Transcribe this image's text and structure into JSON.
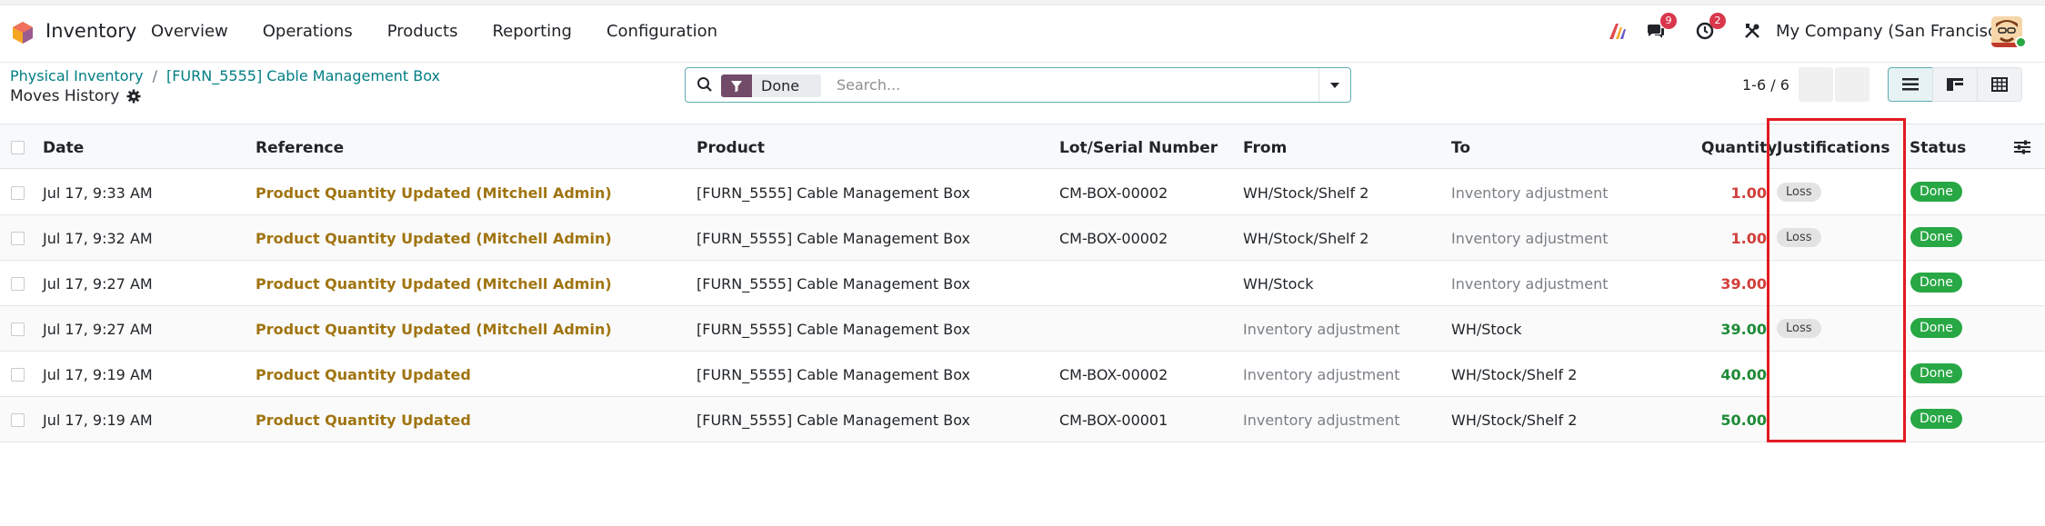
{
  "app": {
    "name": "Inventory"
  },
  "menu": [
    "Overview",
    "Operations",
    "Products",
    "Reporting",
    "Configuration"
  ],
  "systray": {
    "messages_count": "9",
    "activities_count": "2",
    "company": "My Company (San Francisco)"
  },
  "breadcrumb": {
    "crumb1": "Physical Inventory",
    "separator": "/",
    "crumb2": "[FURN_5555] Cable Management Box"
  },
  "page_title": "Moves History",
  "search": {
    "facet": "Done",
    "placeholder": "Search..."
  },
  "pager": {
    "text": "1-6 / 6"
  },
  "columns": [
    "Date",
    "Reference",
    "Product",
    "Lot/Serial Number",
    "From",
    "To",
    "Quantity",
    "Justifications",
    "Status"
  ],
  "rows": [
    {
      "date": "Jul 17, 9:33 AM",
      "reference": "Product Quantity Updated (Mitchell Admin)",
      "product": "[FURN_5555] Cable Management Box",
      "lot": "CM-BOX-00002",
      "from": "WH/Stock/Shelf 2",
      "to": "Inventory adjustment",
      "quantity": "1.00",
      "qty_color": "#d23f3a",
      "justification": "Loss",
      "status": "Done",
      "from_muted": false,
      "to_muted": true
    },
    {
      "date": "Jul 17, 9:32 AM",
      "reference": "Product Quantity Updated (Mitchell Admin)",
      "product": "[FURN_5555] Cable Management Box",
      "lot": "CM-BOX-00002",
      "from": "WH/Stock/Shelf 2",
      "to": "Inventory adjustment",
      "quantity": "1.00",
      "qty_color": "#d23f3a",
      "justification": "Loss",
      "status": "Done",
      "from_muted": false,
      "to_muted": true
    },
    {
      "date": "Jul 17, 9:27 AM",
      "reference": "Product Quantity Updated (Mitchell Admin)",
      "product": "[FURN_5555] Cable Management Box",
      "lot": "",
      "from": "WH/Stock",
      "to": "Inventory adjustment",
      "quantity": "39.00",
      "qty_color": "#d23f3a",
      "justification": "",
      "status": "Done",
      "from_muted": false,
      "to_muted": true
    },
    {
      "date": "Jul 17, 9:27 AM",
      "reference": "Product Quantity Updated (Mitchell Admin)",
      "product": "[FURN_5555] Cable Management Box",
      "lot": "",
      "from": "Inventory adjustment",
      "to": "WH/Stock",
      "quantity": "39.00",
      "qty_color": "#1f8a36",
      "justification": "Loss",
      "status": "Done",
      "from_muted": true,
      "to_muted": false
    },
    {
      "date": "Jul 17, 9:19 AM",
      "reference": "Product Quantity Updated",
      "product": "[FURN_5555] Cable Management Box",
      "lot": "CM-BOX-00002",
      "from": "Inventory adjustment",
      "to": "WH/Stock/Shelf 2",
      "quantity": "40.00",
      "qty_color": "#1f8a36",
      "justification": "",
      "status": "Done",
      "from_muted": true,
      "to_muted": false
    },
    {
      "date": "Jul 17, 9:19 AM",
      "reference": "Product Quantity Updated",
      "product": "[FURN_5555] Cable Management Box",
      "lot": "CM-BOX-00001",
      "from": "Inventory adjustment",
      "to": "WH/Stock/Shelf 2",
      "quantity": "50.00",
      "qty_color": "#1f8a36",
      "justification": "",
      "status": "Done",
      "from_muted": true,
      "to_muted": false
    }
  ]
}
